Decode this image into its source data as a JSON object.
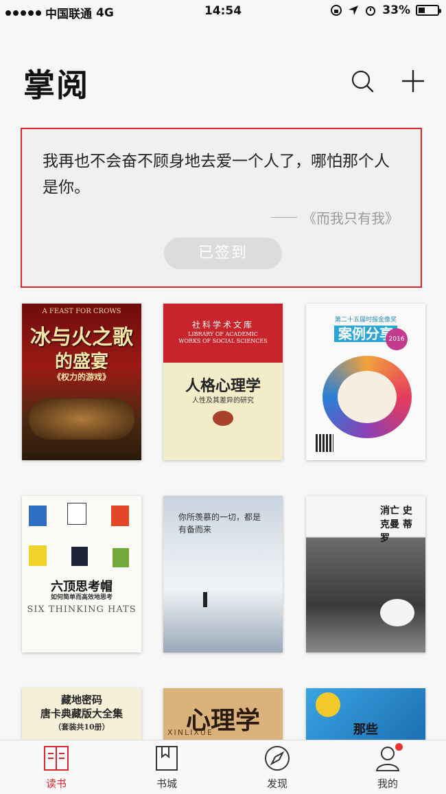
{
  "status_bar": {
    "carrier": "中国联通",
    "network": "4G",
    "time": "14:54",
    "battery": "33%",
    "battery_level": 0.33
  },
  "header": {
    "title": "掌阅",
    "search_icon": "search-icon",
    "add_icon": "plus-icon"
  },
  "daily_quote": {
    "text": "我再也不会奋不顾身地去爱一个人了，哪怕那个人是你。",
    "source": "《而我只有我》",
    "button": "已签到"
  },
  "books": [
    {
      "title": "冰与火之歌",
      "subtitle": "的盛宴",
      "note": "《权力的游戏》",
      "top": "A FEAST FOR CROWS"
    },
    {
      "series": "社科学术文库",
      "series_en": "LIBRARY OF ACADEMIC WORKS OF SOCIAL SCIENCES",
      "title": "人格心理学",
      "subtitle": "人性及其差异的研究"
    },
    {
      "title": "案例分享",
      "top": "第二十五届时报金像奖",
      "year": "2016"
    },
    {
      "title": "六顶思考帽",
      "subtitle": "如何简单而高效地思考",
      "en": "SIX THINKING HATS"
    },
    {
      "title": "你所羡慕的一切，都是有备而来"
    },
    {
      "title": "消亡 史克曼 蒂罗"
    },
    {
      "title": "藏地密码",
      "subtitle": "唐卡典藏版大全集",
      "note": "（套装共10册）"
    },
    {
      "title": "心理学",
      "en": "XINLIXUE"
    },
    {
      "title": "那些"
    }
  ],
  "tabbar": [
    {
      "label": "读书",
      "icon": "book-open-icon",
      "active": true
    },
    {
      "label": "书城",
      "icon": "bookmark-icon",
      "active": false
    },
    {
      "label": "发现",
      "icon": "compass-icon",
      "active": false
    },
    {
      "label": "我的",
      "icon": "user-icon",
      "active": false
    }
  ],
  "colors": {
    "accent": "#d9252b",
    "background": "#f7f7f8"
  }
}
